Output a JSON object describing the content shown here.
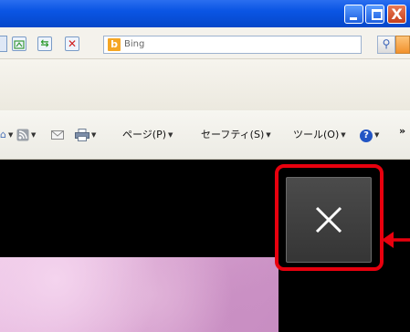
{
  "window": {
    "buttons": {
      "minimize_icon": "minimize-icon",
      "maximize_icon": "restore-icon",
      "close_label": "X"
    }
  },
  "address_bar": {
    "search_logo": "b",
    "search_placeholder": "Bing",
    "search_go_icon": "⚲"
  },
  "command_bar": {
    "page_label": "ページ(P)",
    "safety_label": "セーフティ(S)",
    "tools_label": "ツール(O)",
    "help_label": "?",
    "more_label": "»"
  },
  "overlay": {
    "close_glyph": "close-icon"
  },
  "colors": {
    "titlebar": "#0a55e4",
    "highlight": "#e8000e",
    "overlay_button": "#404040"
  }
}
